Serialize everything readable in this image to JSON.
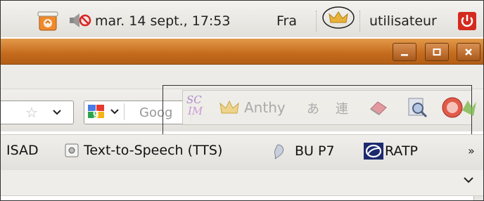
{
  "top_panel": {
    "clock": "mar. 14 sept., 17:53",
    "keyboard_layout": "Fra",
    "user_name": "utilisateur"
  },
  "toolbar": {
    "search_placeholder": "Goog"
  },
  "ime_toolbar": {
    "input_method": "Anthy",
    "kana_glyph": "あ",
    "conversion_glyph": "連"
  },
  "bookmarks": {
    "items": [
      {
        "label": "ISAD",
        "icon": "none"
      },
      {
        "label": "Text-to-Speech (TTS)",
        "icon": "page-icon"
      },
      {
        "label": "BU P7",
        "icon": "bu-logo-icon"
      },
      {
        "label": "RATP",
        "icon": "ratp-logo-icon"
      }
    ],
    "overflow": "»"
  },
  "colors": {
    "title_bar": "#c46a1c",
    "power_red": "#d52a1e",
    "crown_gold": "#e8b23a"
  }
}
